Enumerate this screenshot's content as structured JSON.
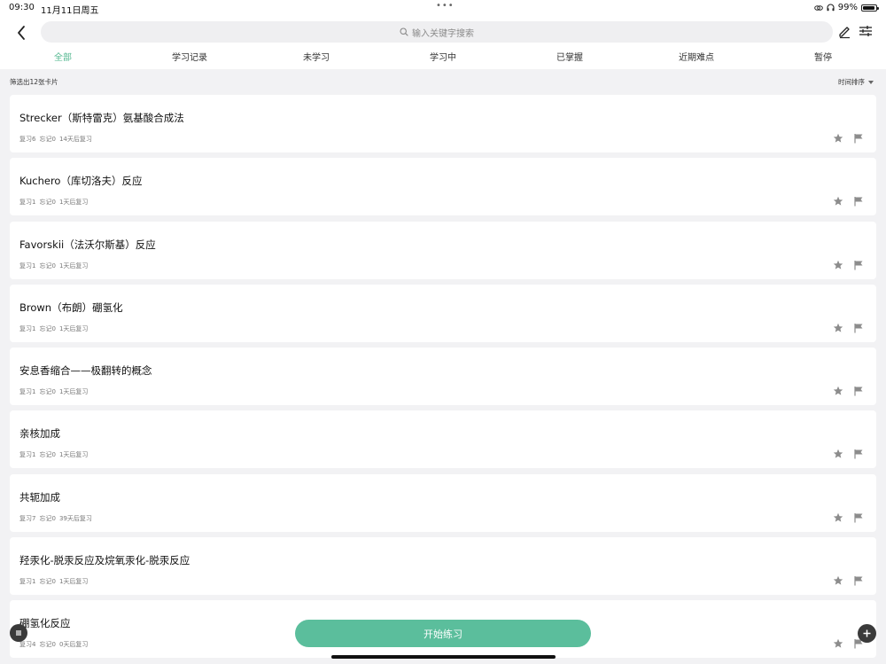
{
  "status_bar": {
    "time": "09:30",
    "date": "11月11日周五",
    "battery": "99%"
  },
  "header": {
    "search_placeholder": "输入关键字搜索"
  },
  "tabs": [
    {
      "label": "全部",
      "active": true
    },
    {
      "label": "学习记录",
      "active": false
    },
    {
      "label": "未学习",
      "active": false
    },
    {
      "label": "学习中",
      "active": false
    },
    {
      "label": "已掌握",
      "active": false
    },
    {
      "label": "近期难点",
      "active": false
    },
    {
      "label": "暂停",
      "active": false
    }
  ],
  "filter": {
    "count_text": "筛选出12张卡片",
    "sort_label": "时间排序"
  },
  "cards": [
    {
      "title": "Strecker（斯特雷克）氨基酸合成法",
      "review": "复习6",
      "forget": "忘记0",
      "next": "14天后复习"
    },
    {
      "title": "Kuchero（库切洛夫）反应",
      "review": "复习1",
      "forget": "忘记0",
      "next": "1天后复习"
    },
    {
      "title": "Favorskii（法沃尔斯基）反应",
      "review": "复习1",
      "forget": "忘记0",
      "next": "1天后复习"
    },
    {
      "title": "Brown（布朗）硼氢化",
      "review": "复习1",
      "forget": "忘记0",
      "next": "1天后复习"
    },
    {
      "title": "安息香缩合——极翻转的概念",
      "review": "复习1",
      "forget": "忘记0",
      "next": "1天后复习"
    },
    {
      "title": "亲核加成",
      "review": "复习1",
      "forget": "忘记0",
      "next": "1天后复习"
    },
    {
      "title": "共轭加成",
      "review": "复习7",
      "forget": "忘记0",
      "next": "39天后复习"
    },
    {
      "title": "羟汞化-脱汞反应及烷氧汞化-脱汞反应",
      "review": "复习1",
      "forget": "忘记0",
      "next": "1天后复习"
    },
    {
      "title": "硼氢化反应",
      "review": "复习4",
      "forget": "忘记0",
      "next": "0天后复习"
    }
  ],
  "bottom": {
    "start_label": "开始练习"
  },
  "colors": {
    "accent": "#52b78f",
    "start_button": "#5bbe9c"
  }
}
